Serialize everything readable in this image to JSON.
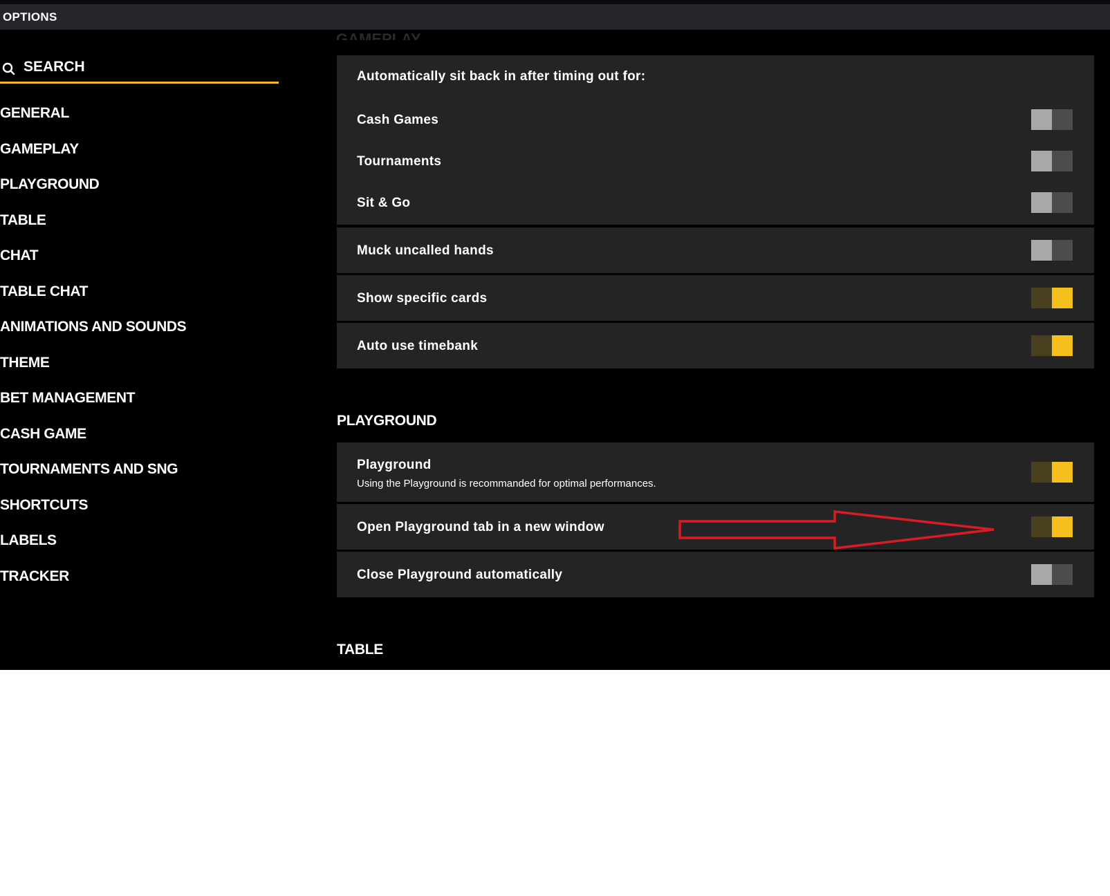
{
  "window": {
    "title": "OPTIONS"
  },
  "sidebar": {
    "search_label": "SEARCH",
    "search_underline_color": "#f5b82e",
    "items": [
      "GENERAL",
      "GAMEPLAY",
      "PLAYGROUND",
      "TABLE",
      "CHAT",
      "TABLE CHAT",
      "ANIMATIONS AND SOUNDS",
      "THEME",
      "BET MANAGEMENT",
      "CASH GAME",
      "TOURNAMENTS AND SNG",
      "SHORTCUTS",
      "LABELS",
      "TRACKER"
    ]
  },
  "gameplay": {
    "auto_sit_back_label": "Automatically sit back in after timing out for:",
    "cash_games": {
      "label": "Cash Games",
      "enabled": false
    },
    "tournaments": {
      "label": "Tournaments",
      "enabled": false
    },
    "sit_and_go": {
      "label": "Sit & Go",
      "enabled": false
    },
    "muck_uncalled": {
      "label": "Muck uncalled hands",
      "enabled": false
    },
    "show_specific_cards": {
      "label": "Show specific cards",
      "enabled": true
    },
    "auto_timebank": {
      "label": "Auto use timebank",
      "enabled": true
    }
  },
  "playground_section": {
    "heading": "PLAYGROUND",
    "playground": {
      "label": "Playground",
      "description": "Using the Playground is recommanded for optimal performances.",
      "enabled": true
    },
    "open_new_window": {
      "label": "Open Playground tab in a new window",
      "enabled": true
    },
    "close_auto": {
      "label": "Close Playground automatically",
      "enabled": false
    }
  },
  "table_section": {
    "heading": "TABLE"
  },
  "colors": {
    "toggle_on_accent": "#f5c01d",
    "toggle_off": "#a8a8a8",
    "annotation_arrow": "#d91c24"
  }
}
